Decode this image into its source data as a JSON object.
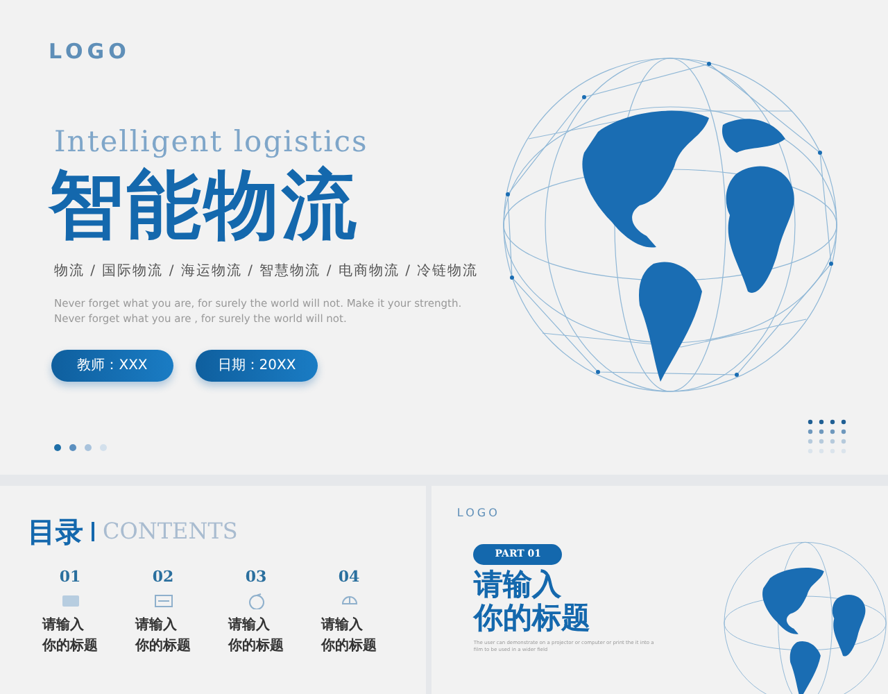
{
  "cover": {
    "logo": "LOGO",
    "subtitle": "Intelligent logistics",
    "title": "智能物流",
    "tags": "物流 / 国际物流 / 海运物流 / 智慧物流 / 电商物流 / 冷链物流",
    "description": "Never forget what you are, for surely the world will not. Make it your strength. Never forget what you are , for surely the world will not.",
    "buttons": [
      {
        "label": "教师：XXX"
      },
      {
        "label": "日期：20XX"
      }
    ],
    "page_dots": [
      {
        "color": "#1f6fa8"
      },
      {
        "color": "#5b8fbf"
      },
      {
        "color": "#a9c3dc"
      },
      {
        "color": "#d3e0ec"
      }
    ]
  },
  "contents": {
    "title": "目录",
    "title_en": "CONTENTS",
    "items": [
      {
        "number": "01",
        "label": "请输入你的标题"
      },
      {
        "number": "02",
        "label": "请输入你的标题"
      },
      {
        "number": "03",
        "label": "请输入你的标题"
      },
      {
        "number": "04",
        "label": "请输入你的标题"
      }
    ]
  },
  "part": {
    "logo": "LOGO",
    "badge": "PART 01",
    "title": "请输入你的标题",
    "description": "The user can demonstrate on a projector or computer or print the it into a film to be used in a wider field"
  }
}
